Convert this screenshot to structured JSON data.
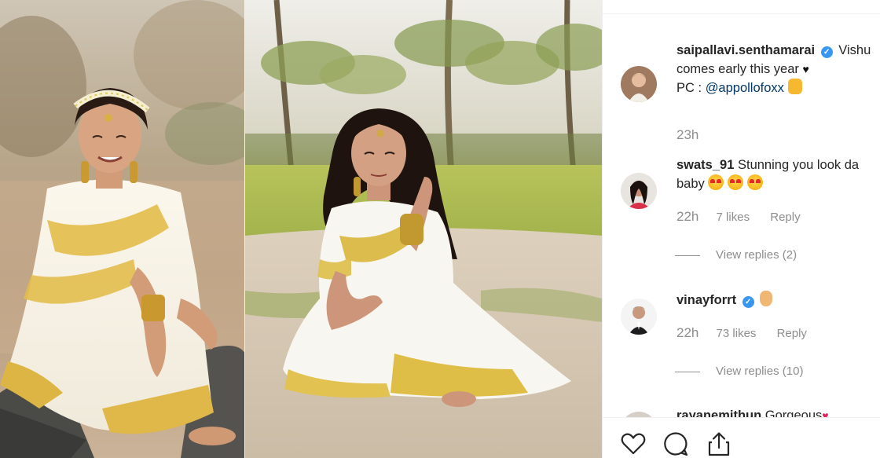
{
  "comments": [
    {
      "username": "saipallavi.senthamarai",
      "verified": true,
      "text_line1": "Vishu",
      "text_line2": "comes early this year",
      "text_line3_prefix": "PC : ",
      "mention": "@appollofoxx",
      "time": "23h"
    },
    {
      "username": "swats_91",
      "verified": false,
      "text_line1": "Stunning you look da",
      "text_line2": "baby",
      "time": "22h",
      "likes": "7 likes",
      "reply_label": "Reply",
      "view_replies": "View replies (2)"
    },
    {
      "username": "vinayforrt",
      "verified": true,
      "time": "22h",
      "likes": "73 likes",
      "reply_label": "Reply",
      "view_replies": "View replies (10)"
    },
    {
      "username": "rayanemithun",
      "text_line1": "Gorgeous"
    }
  ],
  "icons": {
    "like": "heart-outline-icon",
    "comment": "speech-bubble-icon",
    "share": "share-upload-icon",
    "verified": "verified-badge-icon"
  },
  "colors": {
    "text": "#262626",
    "secondary": "#8e8e8e",
    "verified": "#3897f0",
    "mention": "#00376b"
  }
}
